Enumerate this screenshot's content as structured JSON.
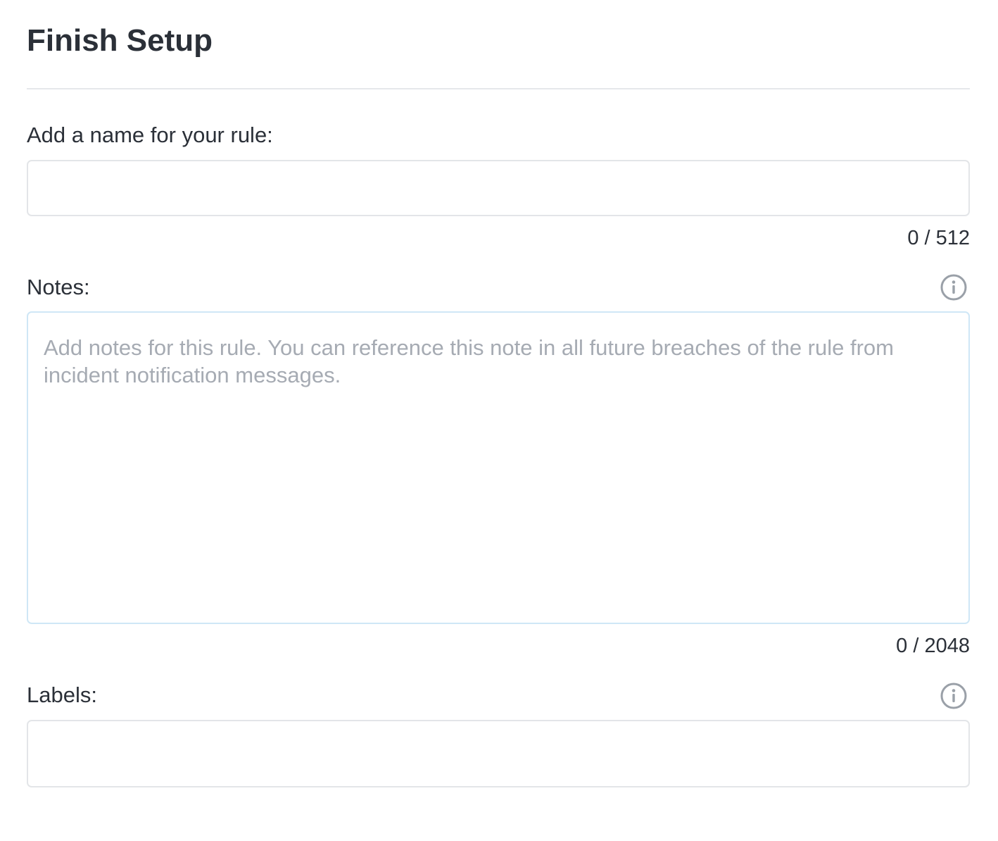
{
  "page": {
    "title": "Finish Setup"
  },
  "name_field": {
    "label": "Add a name for your rule:",
    "value": "",
    "placeholder": "",
    "counter": "0 / 512"
  },
  "notes_field": {
    "label": "Notes:",
    "value": "",
    "placeholder": "Add notes for this rule. You can reference this note in all future breaches of the rule from incident notification messages.",
    "counter": "0 / 2048",
    "info_icon": "info-icon"
  },
  "labels_field": {
    "label": "Labels:",
    "value": "",
    "placeholder": "",
    "info_icon": "info-icon"
  },
  "colors": {
    "text": "#2b3038",
    "placeholder": "#a6abb3",
    "input_border": "#e3e5e8",
    "focus_border": "#cfe7f6",
    "icon": "#9aa0a8"
  }
}
